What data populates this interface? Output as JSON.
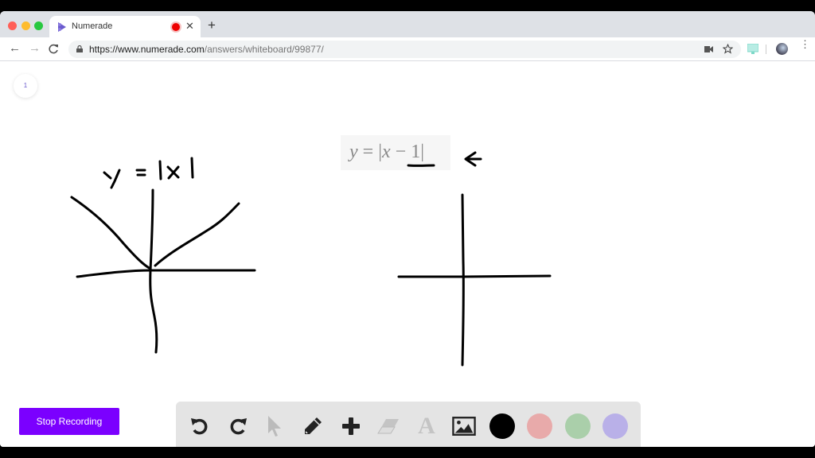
{
  "browser": {
    "tab_title": "Numerade",
    "new_tab_label": "+",
    "close_tab_label": "✕",
    "url_host": "https://www.numerade.com",
    "url_path": "/answers/whiteboard/99877/",
    "nav": {
      "back": "←",
      "forward": "→",
      "reload": "C"
    },
    "colors": {
      "close": "#ff5f57",
      "minimize": "#febc2e",
      "maximize": "#28c840",
      "favicon": "#6a5acd",
      "recording": "#ee0000"
    }
  },
  "whiteboard": {
    "page_number": "1",
    "formula": {
      "lhs": "y",
      "eq": " = |",
      "var": "x",
      "rest": " − 1|"
    },
    "handwritten_label_left": "y = |x|",
    "stop_recording_label": "Stop Recording"
  },
  "toolbar": {
    "tools": [
      {
        "name": "undo",
        "active": true
      },
      {
        "name": "redo",
        "active": true
      },
      {
        "name": "select",
        "active": false
      },
      {
        "name": "pen",
        "active": true
      },
      {
        "name": "add",
        "active": true
      },
      {
        "name": "eraser",
        "active": false
      },
      {
        "name": "text",
        "active": false,
        "glyph": "A"
      },
      {
        "name": "image",
        "active": true
      }
    ],
    "colors": [
      {
        "name": "black",
        "hex": "#000000"
      },
      {
        "name": "red",
        "hex": "#e8aaaa"
      },
      {
        "name": "green",
        "hex": "#aacfaa"
      },
      {
        "name": "purple",
        "hex": "#b9b0e8"
      }
    ]
  }
}
